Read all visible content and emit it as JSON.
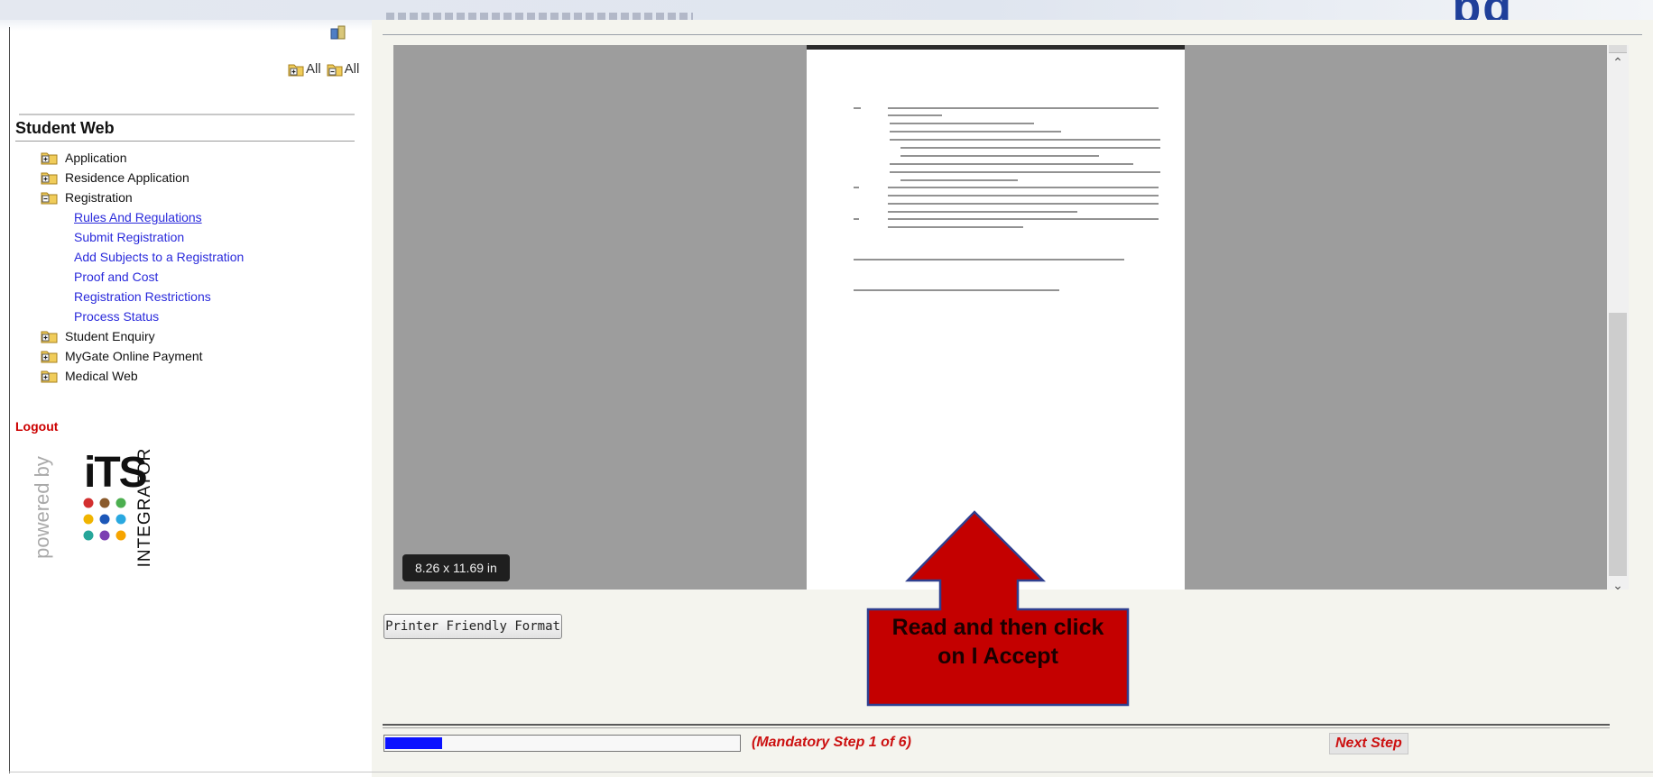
{
  "header": {
    "brand_fragment": "pg"
  },
  "sidebar": {
    "expand_all_label": "All",
    "collapse_all_label": "All",
    "section_title": "Student Web",
    "items": [
      {
        "label": "Application"
      },
      {
        "label": "Residence Application"
      },
      {
        "label": "Registration"
      }
    ],
    "registration_subitems": [
      {
        "label": "Rules And Regulations"
      },
      {
        "label": "Submit Registration"
      },
      {
        "label": "Add Subjects to a Registration"
      },
      {
        "label": "Proof and Cost"
      },
      {
        "label": "Registration Restrictions"
      },
      {
        "label": "Process Status"
      }
    ],
    "more_items": [
      {
        "label": "Student Enquiry"
      },
      {
        "label": "MyGate Online Payment"
      },
      {
        "label": "Medical Web"
      }
    ],
    "logout_label": "Logout",
    "powered_by_text": "powered by",
    "its_text": "iTS",
    "integrator_text": "INTEGRATOR"
  },
  "viewer": {
    "page_size_label": "8.26 x 11.69 in"
  },
  "actions": {
    "printer_friendly_label": "Printer Friendly Format"
  },
  "callout": {
    "line1": "Read and then click",
    "line2": "on I Accept"
  },
  "progress": {
    "fraction": 0.16,
    "step_label": "(Mandatory Step 1 of 6)",
    "next_label": "Next Step"
  },
  "colors": {
    "link_blue": "#2a2adb",
    "logout_red": "#cc0000",
    "progress_blue": "#0b12ff",
    "callout_red": "#c40000",
    "viewer_gray": "#9d9d9d"
  }
}
